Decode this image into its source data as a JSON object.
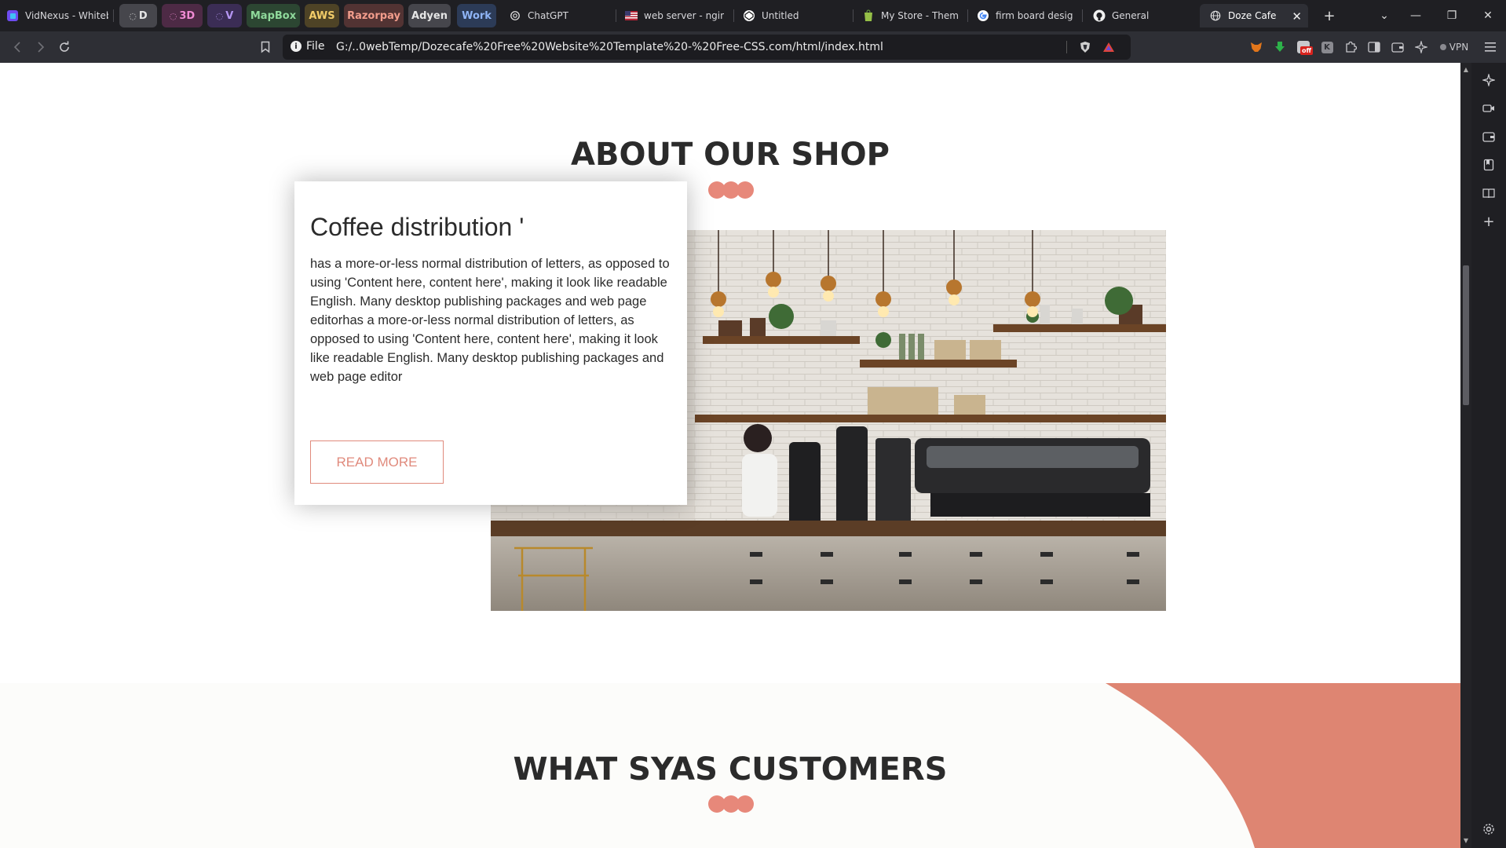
{
  "tabs": {
    "pinned": [
      {
        "title": "VidNexus - Whiteb",
        "icon": "vidnexus-icon"
      }
    ],
    "groups": [
      {
        "label": "D",
        "bg": "#46464c",
        "color": "#e6e6e6",
        "icon": "group-loop-icon"
      },
      {
        "label": "3D",
        "bg": "#4d2a45",
        "color": "#f08bd4",
        "icon": "group-loop-icon"
      },
      {
        "label": "V",
        "bg": "#3b2d55",
        "color": "#b596f2",
        "icon": "group-loop-icon"
      },
      {
        "label": "MapBox",
        "bg": "#2c4632",
        "color": "#8fd99b"
      },
      {
        "label": "AWS",
        "bg": "#4e4326",
        "color": "#f2cc69"
      },
      {
        "label": "Razorpay",
        "bg": "#523333",
        "color": "#f29d8c"
      },
      {
        "label": "Adyen",
        "bg": "#46464c",
        "color": "#e6e6e6"
      },
      {
        "label": "Work",
        "bg": "#2c3b57",
        "color": "#8fb4f5"
      }
    ],
    "items": [
      {
        "title": "ChatGPT",
        "icon": "chatgpt-icon"
      },
      {
        "title": "web server - nginx",
        "icon": "flag-icon"
      },
      {
        "title": "Untitled",
        "icon": "codepen-icon"
      },
      {
        "title": "My Store - Themes",
        "icon": "shopify-icon"
      },
      {
        "title": "firm board design",
        "icon": "google-icon"
      },
      {
        "title": "General",
        "icon": "github-icon"
      }
    ],
    "active": {
      "title": "Doze Cafe",
      "icon": "globe-icon"
    },
    "new_tab": "+",
    "window_controls": {
      "dropdown": "⌄",
      "minimize": "—",
      "restore": "❐",
      "close": "✕"
    }
  },
  "toolbar": {
    "back": "back-icon",
    "forward": "forward-icon",
    "reload": "reload-icon",
    "bookmark": "bookmark-icon",
    "scheme_label": "File",
    "url": "G:/..0webTemp/Dozecafe%20Free%20Website%20Template%20-%20Free-CSS.com/html/index.html",
    "vpn_label": "VPN",
    "ext_off_badge": "off"
  },
  "page": {
    "about_title": "ABOUT OUR SHOP",
    "card_title": "Coffee distribution '",
    "card_text": "has a more-or-less normal distribution of letters, as opposed to using 'Content here, content here', making it look like readable English. Many desktop publishing packages and web page editorhas a more-or-less normal distribution of letters, as opposed to using 'Content here, content here', making it look like readable English. Many desktop publishing packages and web page editor",
    "read_more": "READ MORE",
    "customers_title": "WHAT SYAS CUSTOMERS"
  },
  "colors": {
    "accent": "#e7887a",
    "coral_shape": "#de8572",
    "heading": "#2b2b2b"
  }
}
